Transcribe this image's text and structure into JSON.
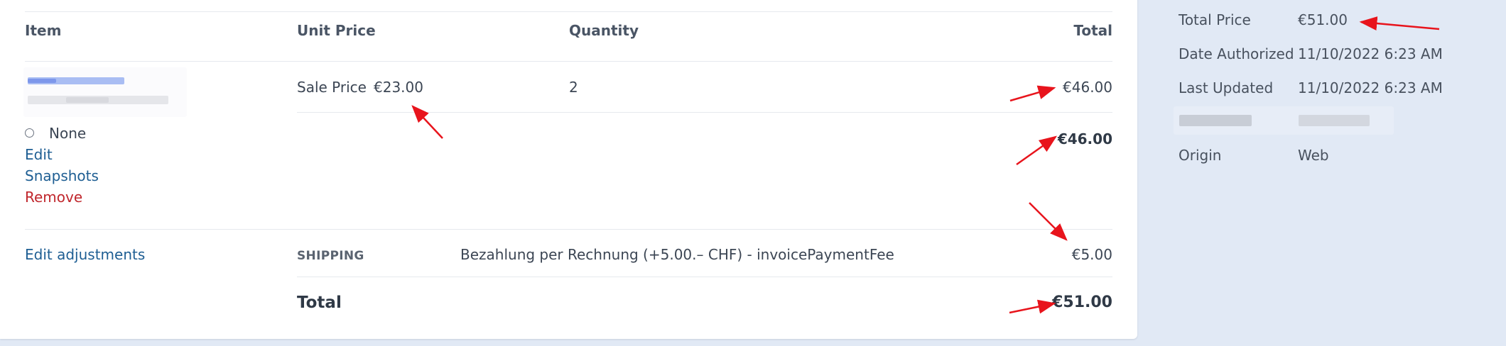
{
  "table": {
    "headers": {
      "item": "Item",
      "unit_price": "Unit Price",
      "quantity": "Quantity",
      "total": "Total"
    },
    "line_item": {
      "price_label": "Sale Price",
      "unit_price": "€23.00",
      "quantity": "2",
      "total": "€46.00",
      "option_label": "None",
      "actions": {
        "edit": "Edit",
        "snapshots": "Snapshots",
        "remove": "Remove"
      }
    },
    "subtotal": "€46.00",
    "adjustments": {
      "edit_link": "Edit adjustments",
      "type": "SHIPPING",
      "description": "Bezahlung per Rechnung (+5.00.– CHF) - invoicePaymentFee",
      "amount": "€5.00"
    },
    "grand_total": {
      "label": "Total",
      "amount": "€51.00"
    }
  },
  "summary": {
    "rows": [
      {
        "label": "Total Price",
        "value": "€51.00"
      },
      {
        "label": "Date Authorized",
        "value": "11/10/2022 6:23 AM"
      },
      {
        "label": "Last Updated",
        "value": "11/10/2022 6:23 AM"
      },
      {
        "label": "Origin",
        "value": "Web"
      }
    ]
  },
  "colors": {
    "link": "#1e5e93",
    "danger": "#c0262c",
    "sidebar_bg": "#e1e9f5",
    "annotation_arrow": "#e8141c"
  }
}
